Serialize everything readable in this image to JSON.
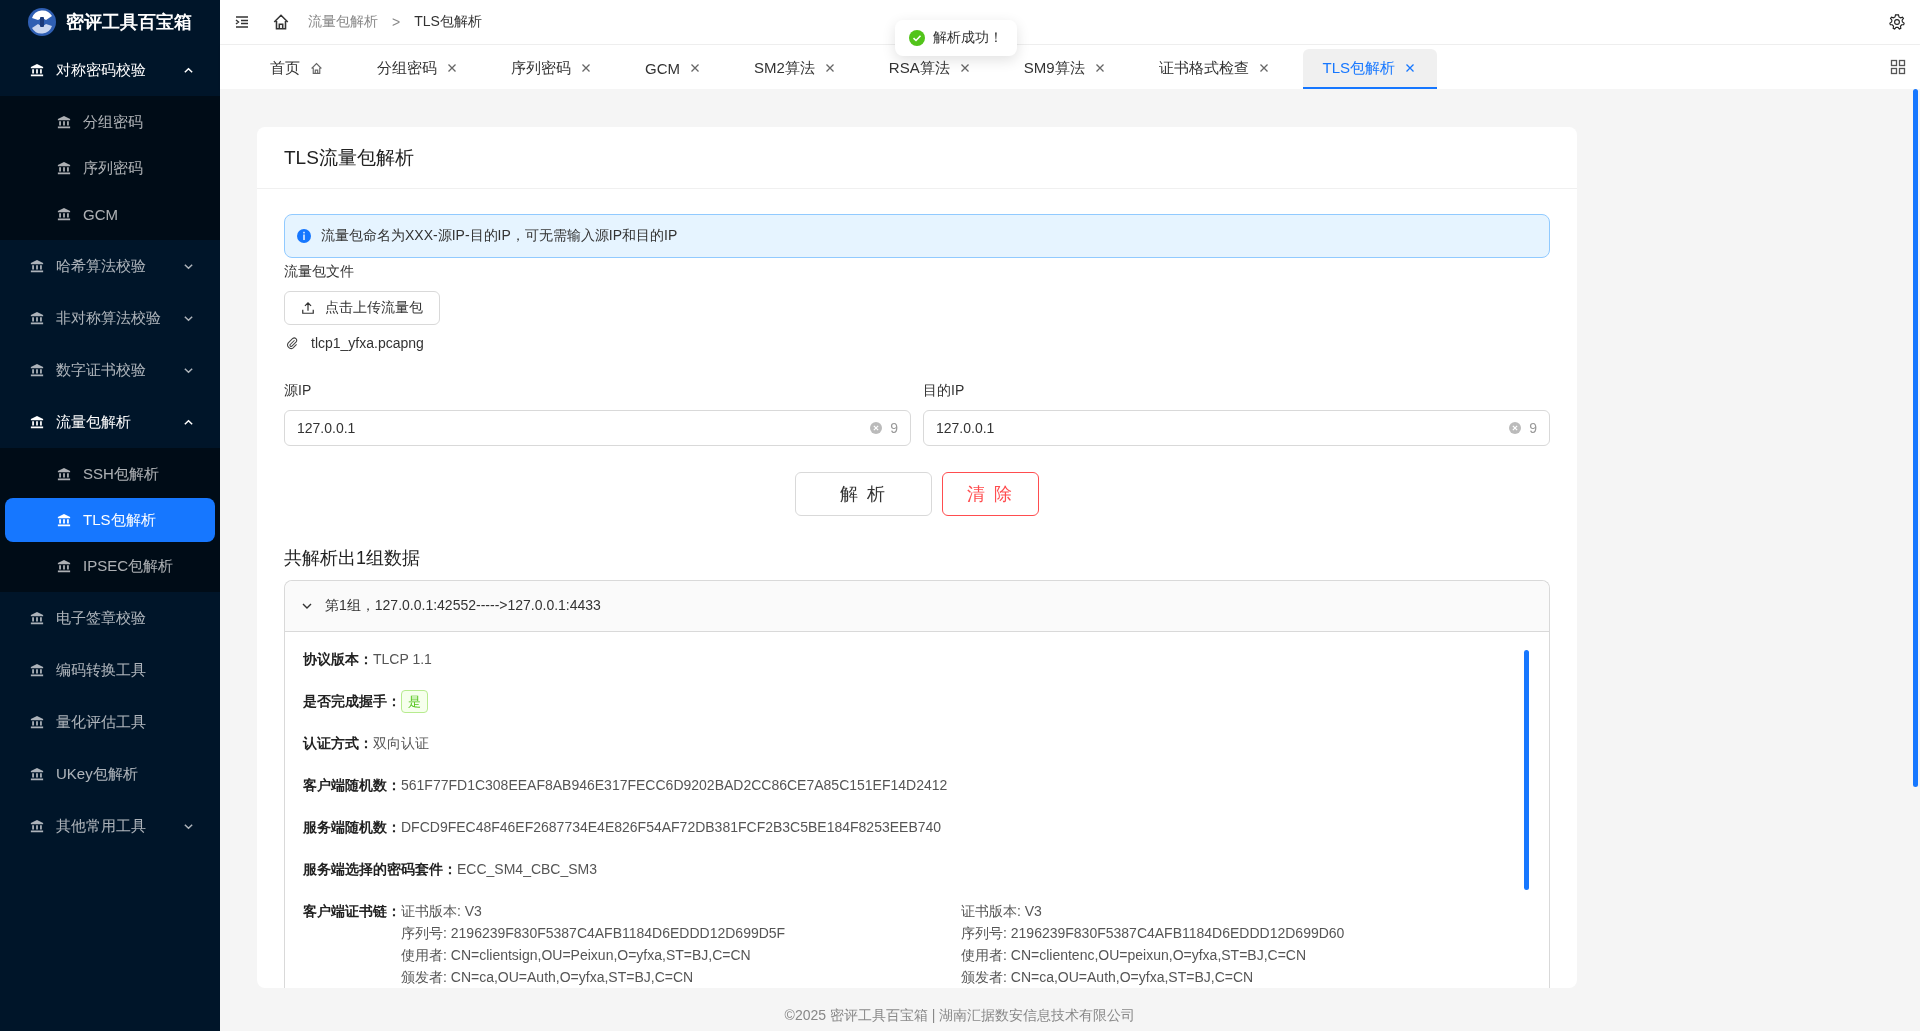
{
  "app": {
    "title": "密评工具百宝箱"
  },
  "sidebar": {
    "items": [
      {
        "label": "对称密码校验",
        "kind": "group",
        "expanded": true,
        "children": [
          {
            "label": "分组密码",
            "selected": false
          },
          {
            "label": "序列密码",
            "selected": false
          },
          {
            "label": "GCM",
            "selected": false
          }
        ]
      },
      {
        "label": "哈希算法校验",
        "kind": "group",
        "expanded": false
      },
      {
        "label": "非对称算法校验",
        "kind": "group",
        "expanded": false
      },
      {
        "label": "数字证书校验",
        "kind": "group",
        "expanded": false
      },
      {
        "label": "流量包解析",
        "kind": "group",
        "expanded": true,
        "children": [
          {
            "label": "SSH包解析",
            "selected": false
          },
          {
            "label": "TLS包解析",
            "selected": true
          },
          {
            "label": "IPSEC包解析",
            "selected": false
          }
        ]
      },
      {
        "label": "电子签章校验",
        "kind": "link",
        "selected": false
      },
      {
        "label": "编码转换工具",
        "kind": "link",
        "selected": false
      },
      {
        "label": "量化评估工具",
        "kind": "link",
        "selected": false
      },
      {
        "label": "UKey包解析",
        "kind": "link",
        "selected": false
      },
      {
        "label": "其他常用工具",
        "kind": "group",
        "expanded": false
      }
    ]
  },
  "breadcrumb": {
    "items": [
      "流量包解析",
      "TLS包解析"
    ],
    "separator": ">"
  },
  "toast": {
    "message": "解析成功！"
  },
  "tabs": [
    {
      "label": "首页",
      "kind": "home",
      "selected": false
    },
    {
      "label": "分组密码",
      "kind": "closable",
      "selected": false
    },
    {
      "label": "序列密码",
      "kind": "closable",
      "selected": false
    },
    {
      "label": "GCM",
      "kind": "closable",
      "selected": false
    },
    {
      "label": "SM2算法",
      "kind": "closable",
      "selected": false
    },
    {
      "label": "RSA算法",
      "kind": "closable",
      "selected": false
    },
    {
      "label": "SM9算法",
      "kind": "closable",
      "selected": false
    },
    {
      "label": "证书格式检查",
      "kind": "closable",
      "selected": false
    },
    {
      "label": "TLS包解析",
      "kind": "closable",
      "selected": true
    }
  ],
  "card": {
    "title": "TLS流量包解析",
    "alert": "流量包命名为XXX-源IP-目的IP，可无需输入源IP和目的IP",
    "file_label": "流量包文件",
    "upload_button": "点击上传流量包",
    "files": [
      "tlcp1_yfxa.pcapng"
    ],
    "fields": [
      {
        "label": "源IP",
        "value": "127.0.0.1",
        "count": "9"
      },
      {
        "label": "目的IP",
        "value": "127.0.0.1",
        "count": "9"
      }
    ],
    "buttons": [
      {
        "label": "解 析",
        "kind": "default"
      },
      {
        "label": "清 除",
        "kind": "danger"
      }
    ],
    "summary": "共解析出1组数据",
    "groups": [
      {
        "title": "第1组，127.0.0.1:42552----->127.0.0.1:4433",
        "expanded": true,
        "details": [
          {
            "label": "协议版本：",
            "kind": "text",
            "value": "TLCP 1.1"
          },
          {
            "label": "是否完成握手：",
            "kind": "tag",
            "value": "是"
          },
          {
            "label": "认证方式：",
            "kind": "text",
            "value": "双向认证"
          },
          {
            "label": "客户端随机数：",
            "kind": "text",
            "value": "561F77FD1C308EEAF8AB946E317FECC6D9202BAD2CC86CE7A85C151EF14D2412"
          },
          {
            "label": "服务端随机数：",
            "kind": "text",
            "value": "DFCD9FEC48F46EF2687734E4E826F54AF72DB381FCF2B3C5BE184F8253EEB740"
          },
          {
            "label": "服务端选择的密码套件：",
            "kind": "text",
            "value": "ECC_SM4_CBC_SM3"
          },
          {
            "label": "客户端证书链：",
            "kind": "certs",
            "certs": [
              [
                "证书版本: V3",
                "序列号: 2196239F830F5387C4AFB1184D6EDDD12D699D5F",
                "使用者: CN=clientsign,OU=Peixun,O=yfxa,ST=BJ,C=CN",
                "颁发者: CN=ca,OU=Auth,O=yfxa,ST=BJ,C=CN"
              ],
              [
                "证书版本: V3",
                "序列号: 2196239F830F5387C4AFB1184D6EDDD12D699D60",
                "使用者: CN=clientenc,OU=peixun,O=yfxa,ST=BJ,C=CN",
                "颁发者: CN=ca,OU=Auth,O=yfxa,ST=BJ,C=CN"
              ]
            ]
          }
        ]
      }
    ]
  },
  "footer": "©2025 密评工具百宝箱 | 湖南汇据数安信息技术有限公司"
}
